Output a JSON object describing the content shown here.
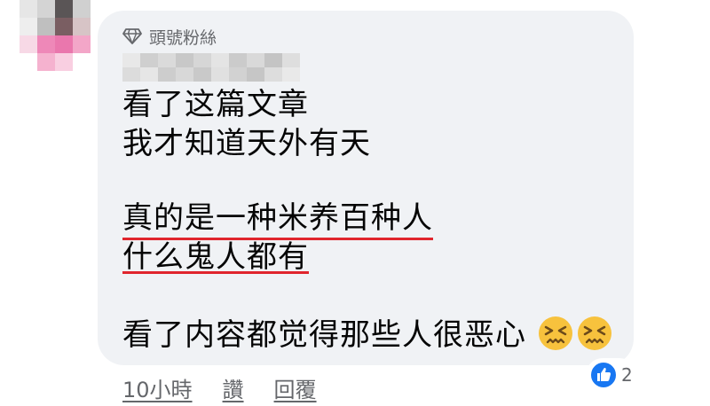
{
  "comment": {
    "badge_label": "頭號粉絲",
    "lines": [
      "看了这篇文章",
      "我才知道天外有天",
      "真的是一种米养百种人",
      "什么鬼人都有",
      "看了内容都觉得那些人很恶心"
    ],
    "emojis": [
      "confounded-face-emoji",
      "confounded-face-emoji"
    ],
    "highlight_color": "#e0252d"
  },
  "reactions": {
    "type": "like-icon",
    "count": "2"
  },
  "actions": {
    "timestamp": "10小時",
    "like_label": "讚",
    "reply_label": "回覆"
  },
  "colors": {
    "bubble": "#f0f2f5",
    "meta_text": "#65676b",
    "like_blue": "#1877f2"
  }
}
